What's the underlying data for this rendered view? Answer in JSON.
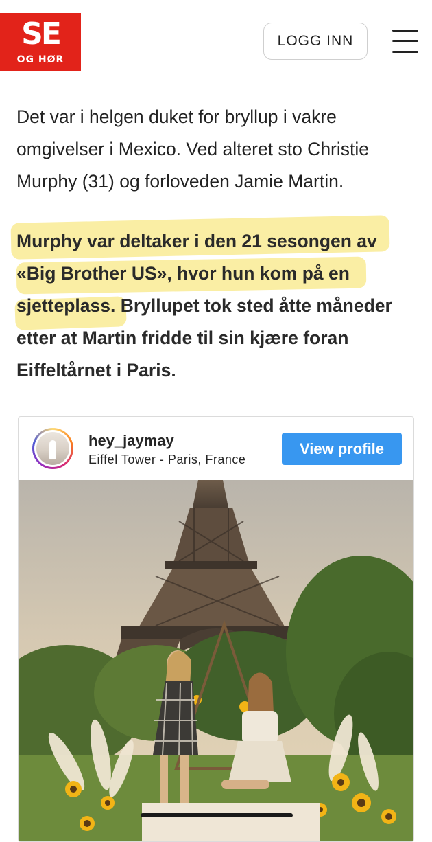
{
  "header": {
    "logo_top": "SE",
    "logo_bottom": "OG HØR",
    "login_label": "LOGG INN",
    "menu_icon": "hamburger-icon"
  },
  "article": {
    "paragraph1": "Det var i helgen duket for bryllup i vakre omgivelser i Mexico. Ved alteret sto Christie Murphy (31) og forloveden Jamie Martin.",
    "paragraph2": "Murphy var deltaker i den 21 sesongen av «Big Brother US», hvor hun kom på en sjetteplass. Bryllupet tok sted åtte måneder etter at Martin fridde til sin kjære foran Eiffeltårnet i Paris."
  },
  "embed": {
    "username": "hey_jaymay",
    "location": "Eiffel Tower - Paris, France",
    "view_profile_label": "View profile"
  },
  "colors": {
    "brand_red": "#e2231a",
    "instagram_blue": "#3897f0",
    "highlight": "#f5e05a"
  }
}
